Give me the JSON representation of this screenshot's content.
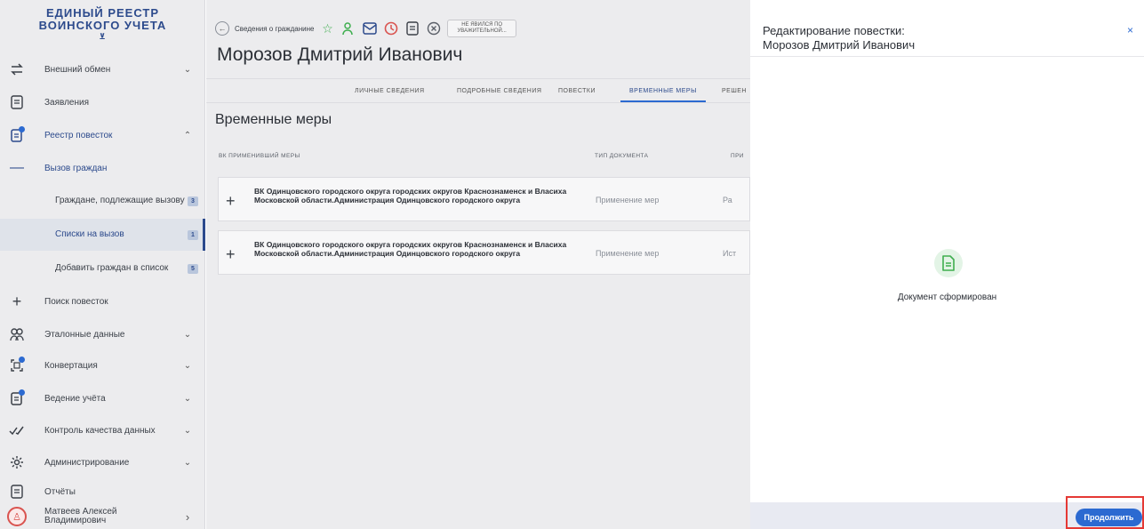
{
  "sidebar": {
    "logo_line1": "ЕДИНЫЙ РЕЕСТР",
    "logo_line2": "ВОИНСКОГО УЧЕТА",
    "items": [
      {
        "label": "Внешний обмен",
        "icon": "arrows-exchange-icon"
      },
      {
        "label": "Заявления",
        "icon": "document-icon"
      },
      {
        "label": "Реестр повесток",
        "icon": "registry-icon"
      },
      {
        "label": "Вызов граждан",
        "icon": "minus-icon"
      },
      {
        "label": "Поиск повесток",
        "icon": "plus-icon"
      },
      {
        "label": "Эталонные данные",
        "icon": "people-icon"
      },
      {
        "label": "Конвертация",
        "icon": "convert-icon"
      },
      {
        "label": "Ведение учёта",
        "icon": "accounting-icon"
      },
      {
        "label": "Контроль качества данных",
        "icon": "check-icon"
      },
      {
        "label": "Администрирование",
        "icon": "gear-icon"
      },
      {
        "label": "Отчёты",
        "icon": "report-icon"
      }
    ],
    "subitems": [
      {
        "label": "Граждане, подлежащие вызову",
        "badge": "3"
      },
      {
        "label": "Списки на вызов",
        "badge": "1"
      },
      {
        "label": "Добавить граждан в список",
        "badge": "5"
      }
    ],
    "user": {
      "name_line1": "Матвеев Алексей",
      "name_line2": "Владимирович"
    }
  },
  "main": {
    "breadcrumb": "Сведения о гражданине",
    "status_pill_line1": "НЕ ЯВИЛСЯ ПО",
    "status_pill_line2": "УВАЖИТЕЛЬНОЙ...",
    "person_name": "Морозов Дмитрий Иванович",
    "tabs": [
      "ЛИЧНЫЕ СВЕДЕНИЯ",
      "ПОДРОБНЫЕ СВЕДЕНИЯ",
      "ПОВЕСТКИ",
      "ВРЕМЕННЫЕ МЕРЫ",
      "РЕШЕН"
    ],
    "active_tab": "ВРЕМЕННЫЕ МЕРЫ",
    "section_title": "Временные меры",
    "table": {
      "headers": [
        "ВК ПРИМЕНИВШИЙ МЕРЫ",
        "ТИП ДОКУМЕНТА",
        "ПРИ"
      ],
      "rows": [
        {
          "org": "ВК Одинцовского городского округа городских округов Краснознаменск и Власиха Московской области.Администрация Одинцовского городского округа",
          "type": "Применение мер",
          "extra": "Ра"
        },
        {
          "org": "ВК Одинцовского городского округа городских округов Краснознаменск и Власиха Московской области.Администрация Одинцовского городского округа",
          "type": "Применение мер",
          "extra": "Ист"
        }
      ]
    }
  },
  "panel": {
    "title_line1": "Редактирование повестки:",
    "title_line2": "Морозов Дмитрий Иванович",
    "close": "×",
    "status_text": "Документ сформирован",
    "continue_label": "Продолжить"
  },
  "colors": {
    "accent": "#2c6ad1",
    "success": "#3fae4f",
    "highlight": "#e53935"
  }
}
